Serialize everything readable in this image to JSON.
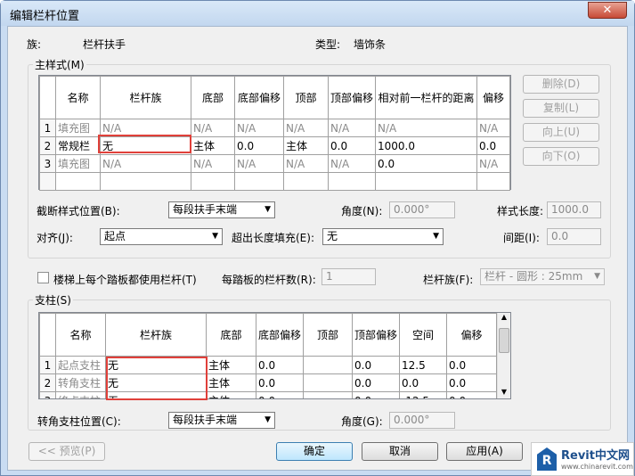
{
  "window": {
    "title": "编辑栏杆位置",
    "close_glyph": "✕"
  },
  "header": {
    "family_label": "族:",
    "family_value": "栏杆扶手",
    "type_label": "类型:",
    "type_value": "墙饰条"
  },
  "main_pattern": {
    "group_label": "主样式(M)",
    "columns": [
      "名称",
      "栏杆族",
      "底部",
      "底部偏移",
      "顶部",
      "顶部偏移",
      "相对前一栏杆的距离",
      "偏移"
    ],
    "rows": [
      {
        "num": "1",
        "cells": [
          "填充图",
          "N/A",
          "N/A",
          "N/A",
          "N/A",
          "N/A",
          "N/A",
          "N/A"
        ]
      },
      {
        "num": "2",
        "cells": [
          "常规栏",
          "无",
          "主体",
          "0.0",
          "主体",
          "0.0",
          "1000.0",
          "0.0"
        ]
      },
      {
        "num": "3",
        "cells": [
          "填充图",
          "N/A",
          "N/A",
          "N/A",
          "N/A",
          "N/A",
          "0.0",
          "N/A"
        ]
      }
    ],
    "buttons": {
      "delete": "删除(D)",
      "copy": "复制(L)",
      "up": "向上(U)",
      "down": "向下(O)"
    },
    "break_label": "截断样式位置(B):",
    "break_value": "每段扶手末端",
    "angle_label": "角度(N):",
    "angle_value": "0.000°",
    "length_label": "样式长度:",
    "length_value": "1000.0",
    "justify_label": "对齐(J):",
    "justify_value": "起点",
    "excess_label": "超出长度填充(E):",
    "excess_value": "无",
    "spacing_label": "间距(I):",
    "spacing_value": "0.0"
  },
  "per_tread": {
    "checkbox_label": "楼梯上每个踏板都使用栏杆(T)",
    "count_label": "每踏板的栏杆数(R):",
    "count_value": "1",
    "family_label": "栏杆族(F):",
    "family_value": "栏杆 - 圆形 : 25mm"
  },
  "posts": {
    "group_label": "支柱(S)",
    "columns": [
      "名称",
      "栏杆族",
      "底部",
      "底部偏移",
      "顶部",
      "顶部偏移",
      "空间",
      "偏移"
    ],
    "rows": [
      {
        "num": "1",
        "cells": [
          "起点支柱",
          "无",
          "主体",
          "0.0",
          "",
          "0.0",
          "12.5",
          "0.0"
        ]
      },
      {
        "num": "2",
        "cells": [
          "转角支柱",
          "无",
          "主体",
          "0.0",
          "",
          "0.0",
          "0.0",
          "0.0"
        ]
      },
      {
        "num": "3",
        "cells": [
          "终点支柱",
          "无",
          "主体",
          "0.0",
          "",
          "0.0",
          "-12.5",
          "0.0"
        ]
      }
    ],
    "corner_label": "转角支柱位置(C):",
    "corner_value": "每段扶手末端",
    "angle_label": "角度(G):",
    "angle_value": "0.000°"
  },
  "footer": {
    "preview": "<< 预览(P)",
    "ok": "确定",
    "cancel": "取消",
    "apply": "应用(A)"
  },
  "watermark": {
    "brand": "Revit中文网",
    "url": "www.chinarevit.com"
  }
}
